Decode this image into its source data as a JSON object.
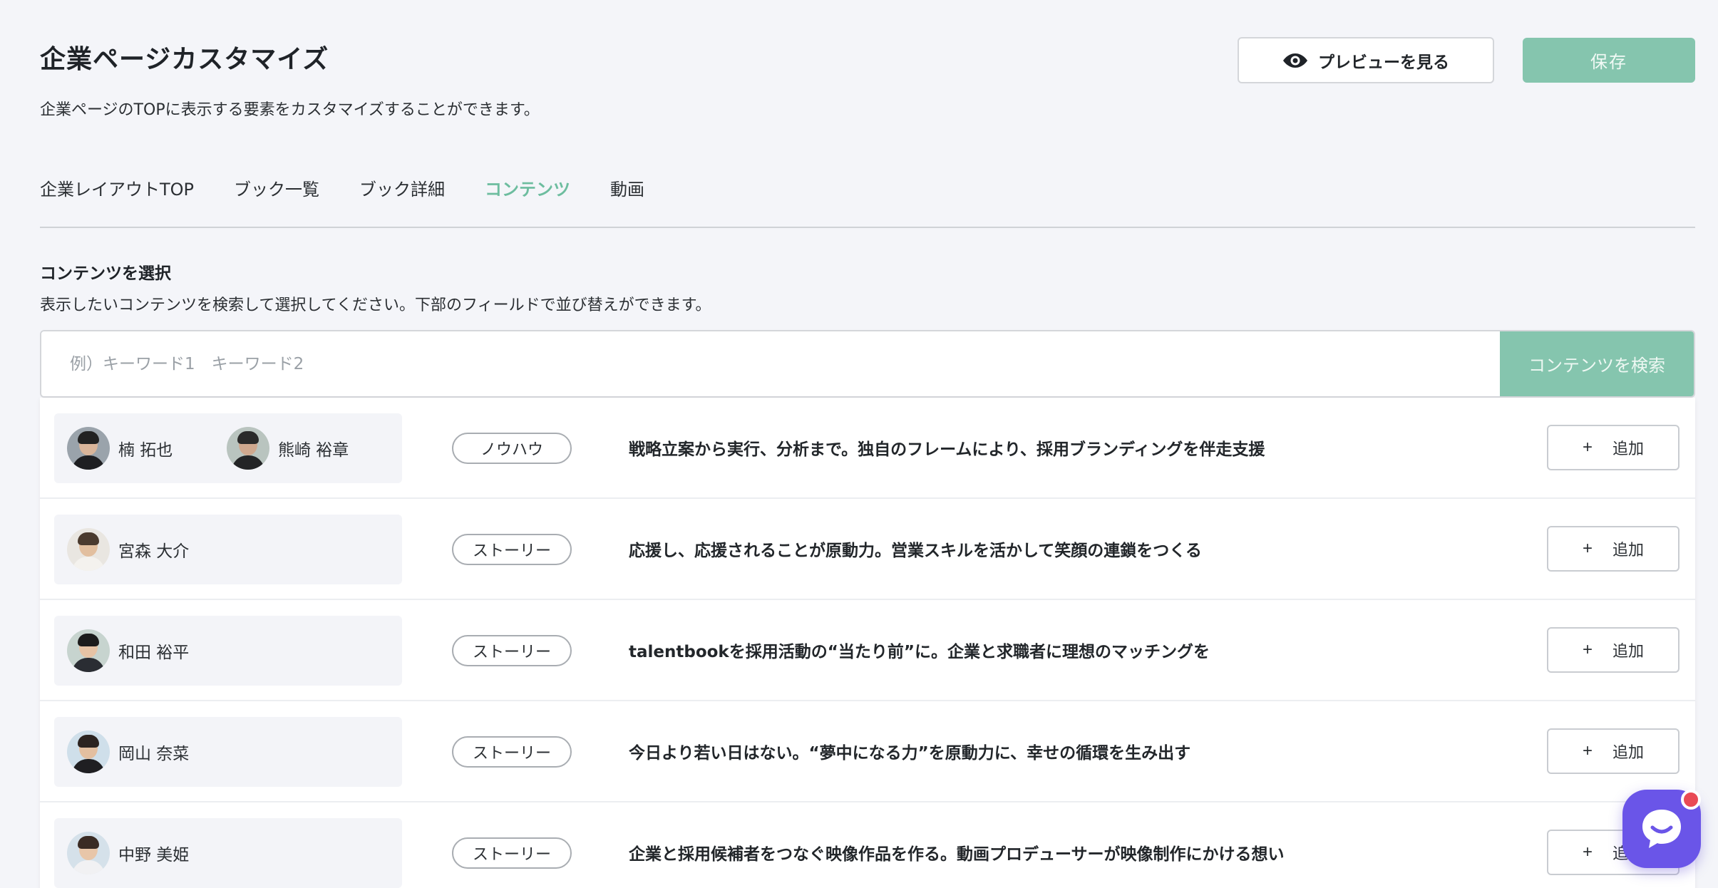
{
  "header": {
    "title": "企業ページカスタマイズ",
    "description": "企業ページのTOPに表示する要素をカスタマイズすることができます。",
    "preview_label": "プレビューを見る",
    "save_label": "保存"
  },
  "tabs": [
    {
      "label": "企業レイアウトTOP",
      "active": false
    },
    {
      "label": "ブック一覧",
      "active": false
    },
    {
      "label": "ブック詳細",
      "active": false
    },
    {
      "label": "コンテンツ",
      "active": true
    },
    {
      "label": "動画",
      "active": false
    }
  ],
  "section": {
    "title": "コンテンツを選択",
    "description": "表示したいコンテンツを検索して選択してください。下部のフィールドで並び替えができます。"
  },
  "search": {
    "placeholder": "例）キーワード1　キーワード2",
    "value": "",
    "button_label": "コンテンツを検索"
  },
  "results": [
    {
      "authors": [
        "楠 拓也",
        "熊崎 裕章"
      ],
      "category": "ノウハウ",
      "title": "戦略立案から実行、分析まで。独自のフレームにより、採用ブランディングを伴走支援",
      "add_label": "追加"
    },
    {
      "authors": [
        "宮森 大介"
      ],
      "category": "ストーリー",
      "title": "応援し、応援されることが原動力。営業スキルを活かして笑顔の連鎖をつくる",
      "add_label": "追加"
    },
    {
      "authors": [
        "和田 裕平"
      ],
      "category": "ストーリー",
      "title": "talentbookを採用活動の“当たり前”に。企業と求職者に理想のマッチングを",
      "add_label": "追加"
    },
    {
      "authors": [
        "岡山 奈菜"
      ],
      "category": "ストーリー",
      "title": "今日より若い日はない。“夢中になる力”を原動力に、幸せの循環を生み出す",
      "add_label": "追加"
    },
    {
      "authors": [
        "中野 美姫"
      ],
      "category": "ストーリー",
      "title": "企業と採用候補者をつなぐ映像作品を作る。動画プロデューサーが映像制作にかける想い",
      "add_label": "追加"
    }
  ],
  "icons": {
    "preview": "eye-icon",
    "add": "plus-icon",
    "chat": "chat-icon"
  },
  "colors": {
    "accent": "#85c5ae",
    "active_tab": "#6dbd9f",
    "chat": "#6a55e8",
    "notification": "#e94a55"
  }
}
